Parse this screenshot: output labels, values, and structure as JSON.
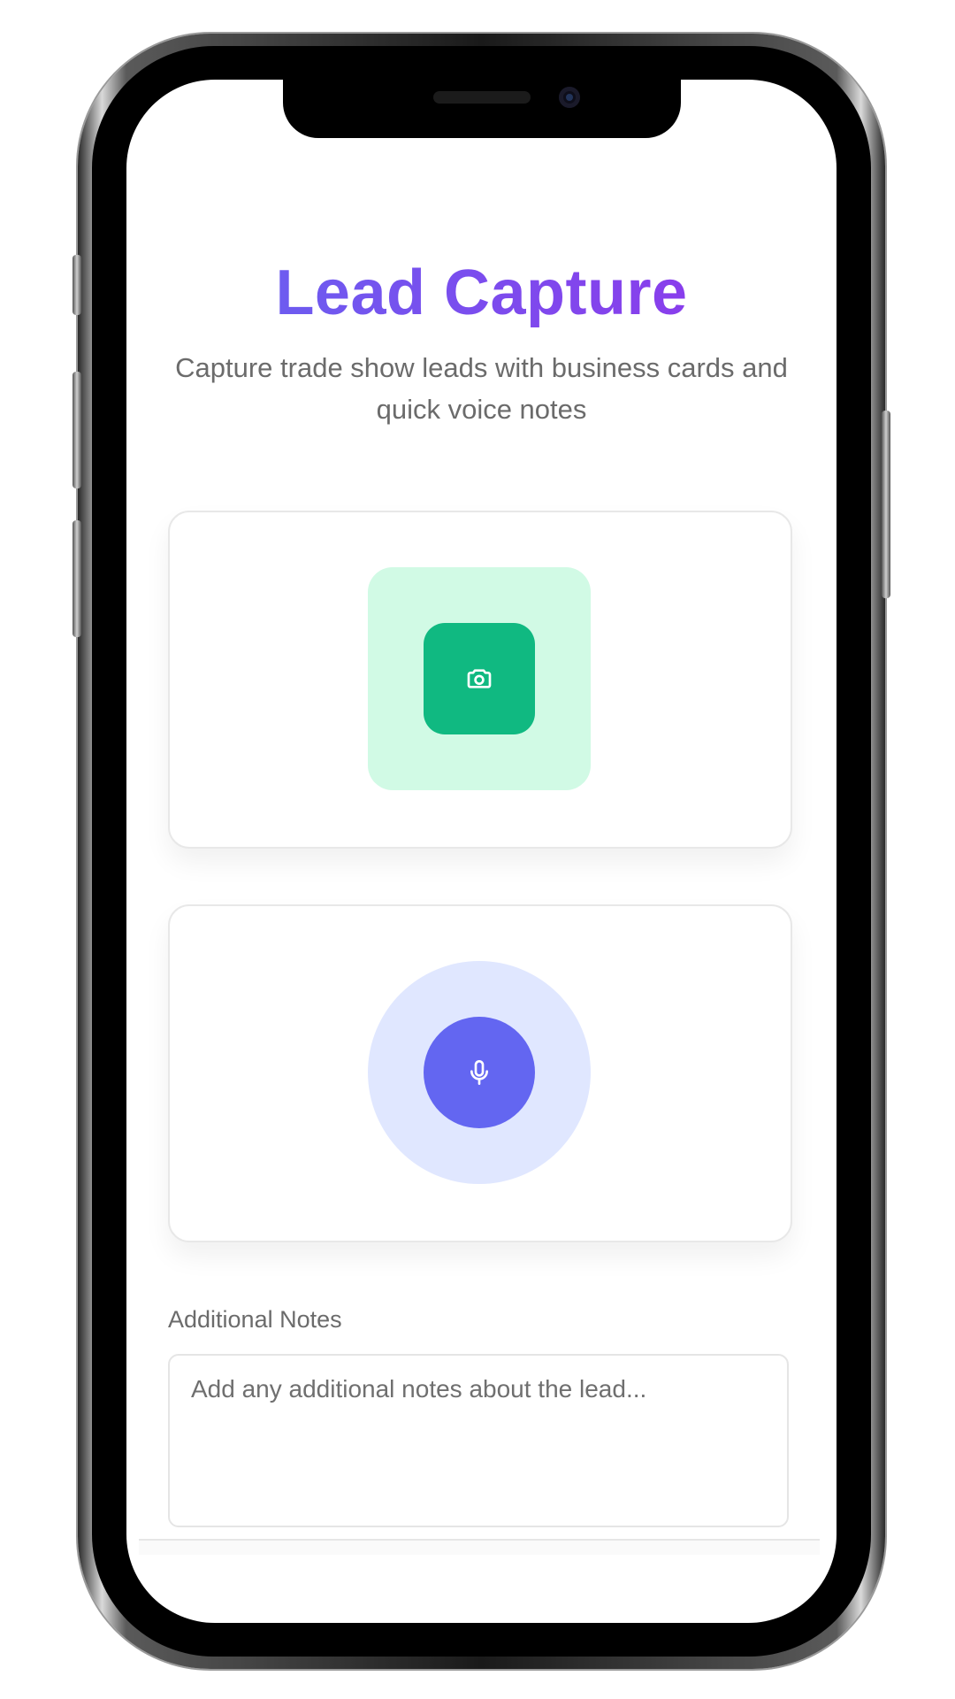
{
  "app": {
    "title": "Lead Capture",
    "subtitle": "Capture trade show leads with business cards and quick voice notes",
    "accent_gradient": [
      "#6366f1",
      "#9333ea"
    ]
  },
  "scan_card": {
    "icon": "camera-icon",
    "button_color": "#10b981",
    "halo_color": "#d1fae5"
  },
  "voice_card": {
    "icon": "microphone-icon",
    "button_color": "#6366f1",
    "halo_color": "#e0e7ff"
  },
  "notes": {
    "label": "Additional Notes",
    "placeholder": "Add any additional notes about the lead...",
    "value": ""
  }
}
